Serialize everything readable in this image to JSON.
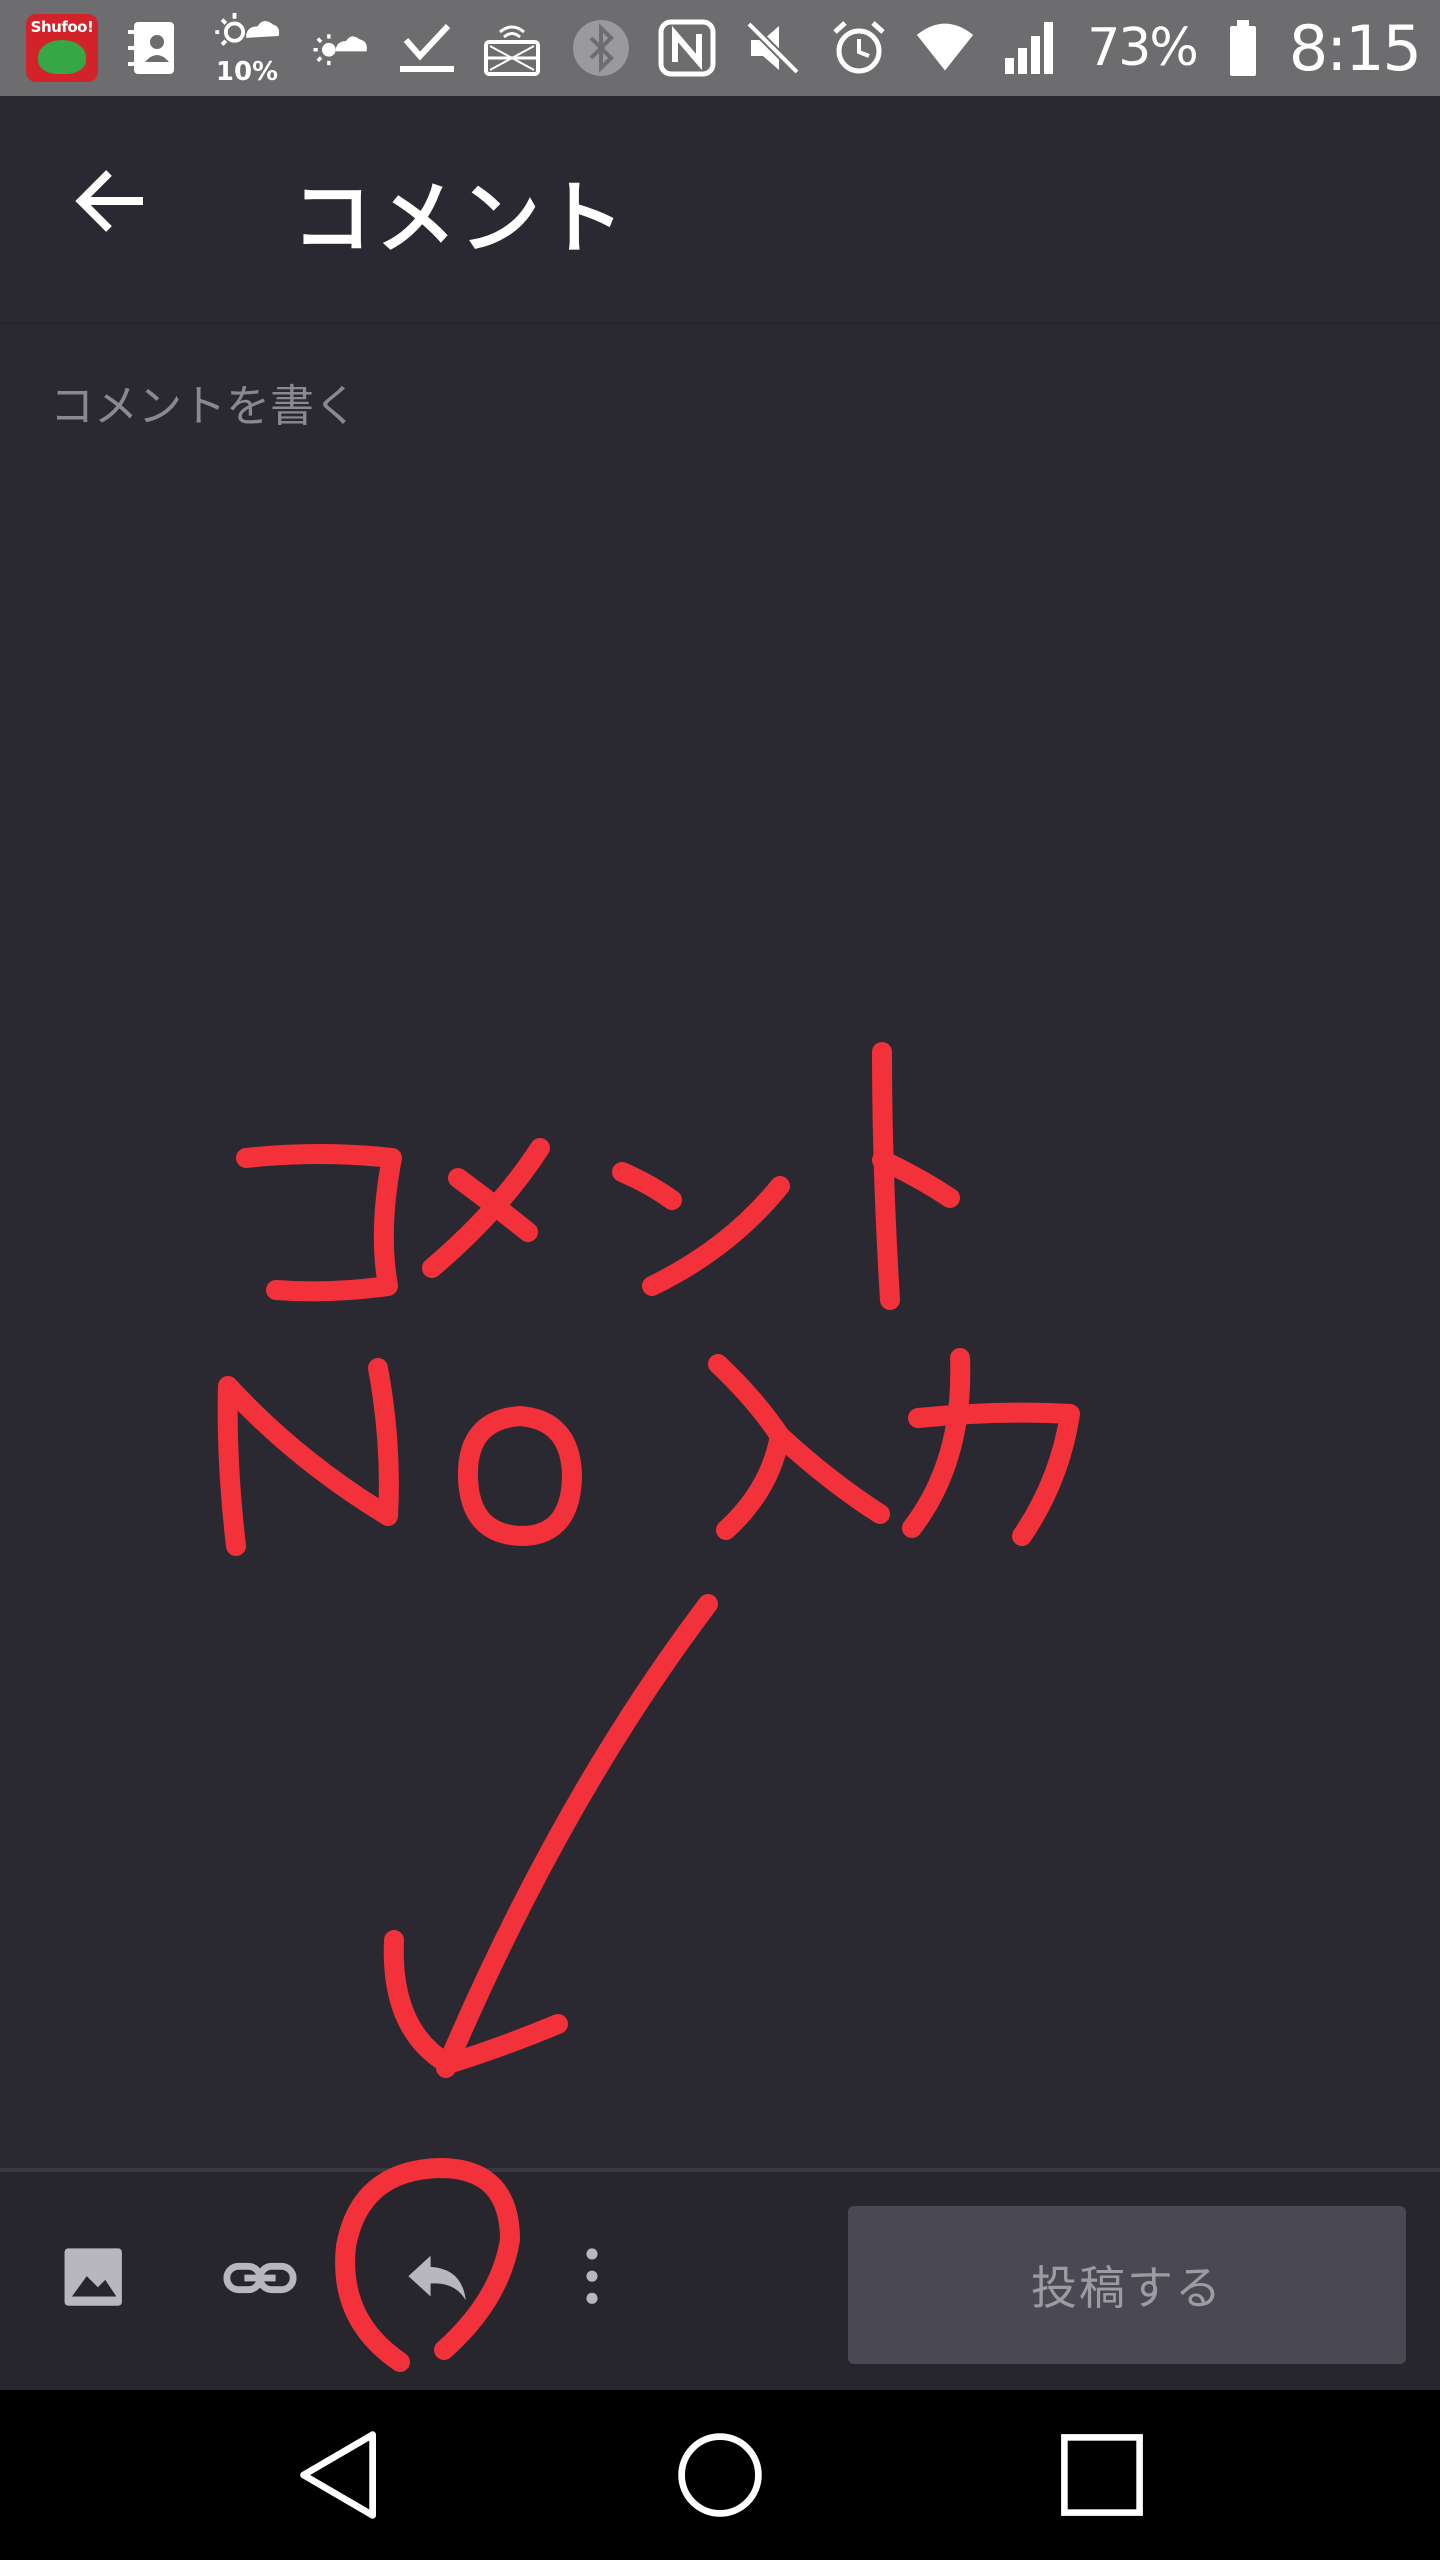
{
  "status_bar": {
    "weather_pct": "10%",
    "battery_pct": "73%",
    "time": "8:15",
    "app_icon_label": "Shufoo!"
  },
  "app_bar": {
    "title": "コメント"
  },
  "comment": {
    "placeholder": "コメントを書く"
  },
  "toolbar": {
    "post_label": "投稿する"
  },
  "annotation": {
    "line1": "コメント",
    "line2": "No 入力"
  },
  "colors": {
    "background": "#2a2932",
    "status_bar": "#6d6d6f",
    "toolbar": "#27262d",
    "post_button": "#4a4953",
    "annotation_red": "#f2313a"
  }
}
